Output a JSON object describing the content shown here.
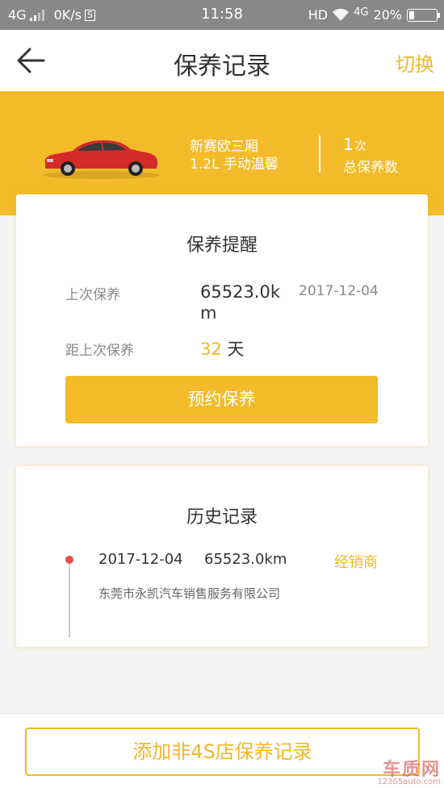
{
  "status_bar": {
    "network": "4G",
    "speed": "0K/s",
    "s_badge": "S",
    "time": "11:58",
    "hd": "HD",
    "net2": "4G",
    "battery": "20%",
    "battery_level": 0.2
  },
  "header": {
    "title": "保养记录",
    "switch_label": "切换"
  },
  "car": {
    "name_line1": "新赛欧三厢",
    "name_line2": "1.2L 手动温馨",
    "count": "1",
    "count_unit": "次",
    "count_label": "总保养数"
  },
  "reminder": {
    "title": "保养提醒",
    "last_label": "上次保养",
    "last_km": "65523.0km",
    "last_date": "2017-12-04",
    "since_label": "距上次保养",
    "since_days": "32",
    "since_unit": "天",
    "book_button": "预约保养"
  },
  "history": {
    "title": "历史记录",
    "records": [
      {
        "date": "2017-12-04",
        "km": "65523.0km",
        "type": "经销商",
        "shop": "东莞市永凯汽车销售服务有限公司"
      }
    ]
  },
  "footer": {
    "add_button": "添加非4S店保养记录"
  },
  "watermark": {
    "line1": "车质网",
    "line2": "12365auto.com"
  },
  "colors": {
    "accent": "#f3bb2a",
    "accent_text": "#f0b828",
    "timeline_dot": "#f04a4a"
  }
}
